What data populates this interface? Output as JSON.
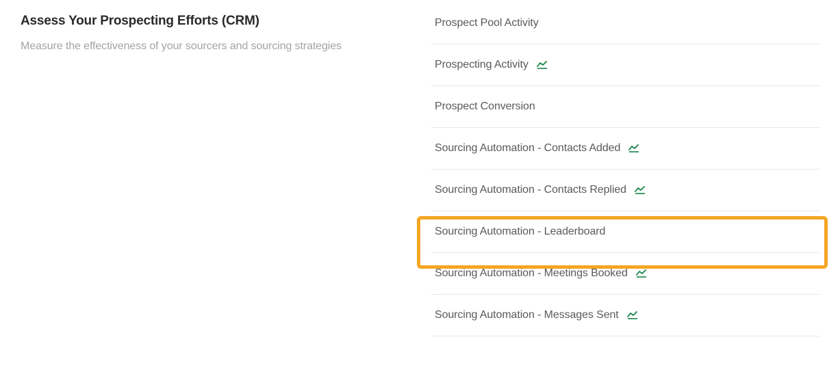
{
  "left": {
    "heading": "Assess Your Prospecting Efforts (CRM)",
    "subheading": "Measure the effectiveness of your sourcers and sourcing strategies"
  },
  "items": [
    {
      "label": "Prospect Pool Activity",
      "has_chart": false
    },
    {
      "label": "Prospecting Activity",
      "has_chart": true
    },
    {
      "label": "Prospect Conversion",
      "has_chart": false
    },
    {
      "label": "Sourcing Automation - Contacts Added",
      "has_chart": true
    },
    {
      "label": "Sourcing Automation - Contacts Replied",
      "has_chart": true
    },
    {
      "label": "Sourcing Automation - Leaderboard",
      "has_chart": false
    },
    {
      "label": "Sourcing Automation - Meetings Booked",
      "has_chart": true
    },
    {
      "label": "Sourcing Automation - Messages Sent",
      "has_chart": true
    }
  ],
  "highlight_index": 5,
  "colors": {
    "chart_icon": "#178246",
    "highlight": "#f5a623"
  }
}
